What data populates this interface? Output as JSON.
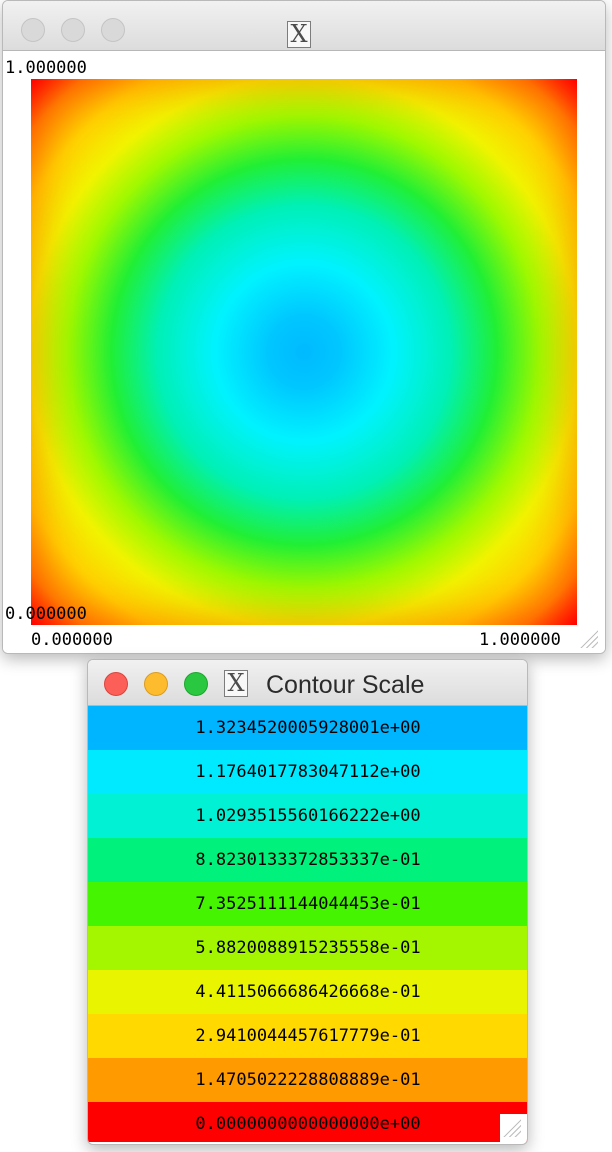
{
  "plot_window": {
    "title": "",
    "axis": {
      "top_left": "1.000000",
      "bottom_left": "0.000000",
      "x_min": "0.000000",
      "x_max": "1.000000"
    }
  },
  "contour_window": {
    "title": "Contour Scale",
    "rows": [
      {
        "label": "1.3234520005928001e+00",
        "color": "#00b5ff"
      },
      {
        "label": "1.1764017783047112e+00",
        "color": "#00eaff"
      },
      {
        "label": "1.0293515560166222e+00",
        "color": "#00f1d3"
      },
      {
        "label": "8.8230133372853337e-01",
        "color": "#00f17c"
      },
      {
        "label": "7.3525111144044453e-01",
        "color": "#44f400"
      },
      {
        "label": "5.8820088915235558e-01",
        "color": "#a4f500"
      },
      {
        "label": "4.4115066686426668e-01",
        "color": "#e8f400"
      },
      {
        "label": "2.9410044457617779e-01",
        "color": "#ffd900"
      },
      {
        "label": "1.4705022228808889e-01",
        "color": "#ff9a00"
      },
      {
        "label": "0.0000000000000000e+00",
        "color": "#ff0000"
      }
    ]
  },
  "icons": {
    "x11": "X"
  }
}
